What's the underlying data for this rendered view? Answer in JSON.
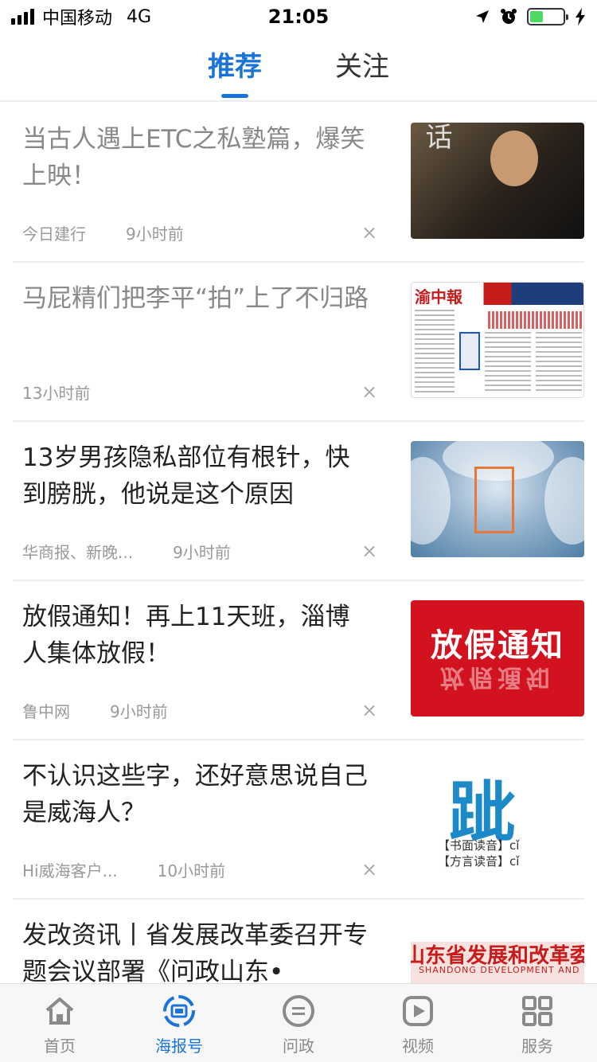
{
  "status": {
    "carrier": "中国移动",
    "network": "4G",
    "time": "21:05"
  },
  "tabs": [
    {
      "label": "推荐",
      "active": true
    },
    {
      "label": "关注",
      "active": false
    }
  ],
  "feed": [
    {
      "title": "当古人遇上ETC之私塾篇，爆笑上映！",
      "source": "今日建行",
      "time": "9小时前",
      "read": true,
      "thumb_text": "话"
    },
    {
      "title": "马屁精们把李平“拍”上了不归路",
      "source": "",
      "time": "13小时前",
      "read": true,
      "thumb_text": "渝中報"
    },
    {
      "title": "13岁男孩隐私部位有根针，快到膀胱，他说是这个原因",
      "source": "华商报、新晚...",
      "time": "9小时前",
      "read": false
    },
    {
      "title": "放假通知！再上11天班，淄博人集体放假！",
      "source": "鲁中网",
      "time": "9小时前",
      "read": false,
      "thumb_text": "放假通知",
      "thumb_mirror": "放假通知"
    },
    {
      "title": "不认识这些字，还好意思说自己是威海人？",
      "source": "Hi威海客户...",
      "time": "10小时前",
      "read": false,
      "thumb_char": "跐",
      "thumb_line1": "【书面读音】cǐ",
      "thumb_line2": "【方言读音】cǐ"
    },
    {
      "title": "发改资讯丨省发展改革委召开专题会议部署《问政山东•",
      "source": "",
      "time": "",
      "read": false,
      "thumb_text": "山东省发展和改革委员",
      "thumb_sub": "SHANDONG DEVELOPMENT AND REFORM COMMISSION"
    }
  ],
  "close_glyph": "×",
  "nav": [
    {
      "label": "首页",
      "icon": "home-icon",
      "active": false
    },
    {
      "label": "海报号",
      "icon": "poster-icon",
      "active": true
    },
    {
      "label": "问政",
      "icon": "inquiry-icon",
      "active": false
    },
    {
      "label": "视频",
      "icon": "video-icon",
      "active": false
    },
    {
      "label": "服务",
      "icon": "grid-icon",
      "active": false
    }
  ],
  "colors": {
    "accent": "#1a73d9",
    "text": "#222222",
    "muted": "#999999"
  }
}
